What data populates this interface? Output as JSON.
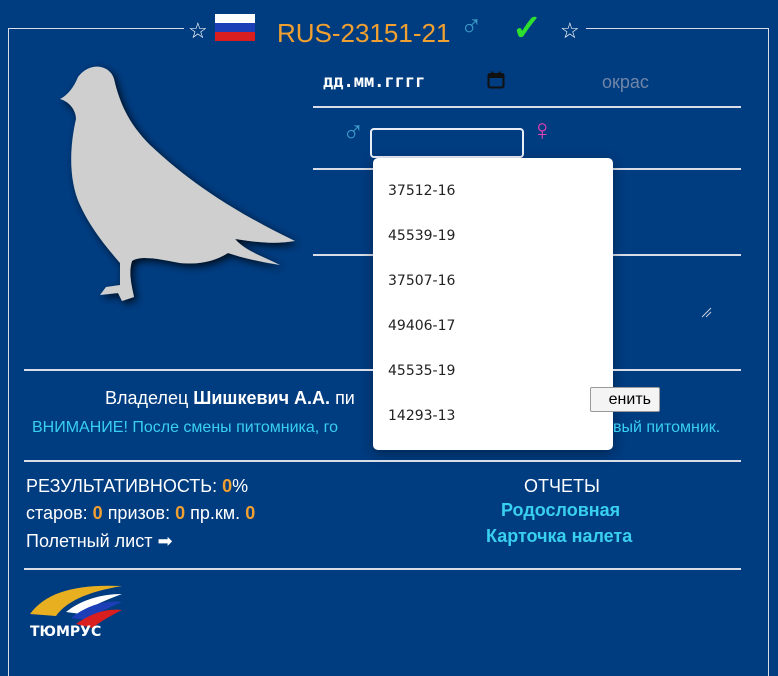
{
  "header": {
    "ring_number": "RUS-23151-21",
    "star_symbol": "☆",
    "male_symbol": "♂",
    "verified_symbol": "✓",
    "flag_colors": [
      "#ffffff",
      "#1c3fb8",
      "#d81e1e"
    ]
  },
  "form": {
    "date_placeholder": "дд.мм.гггг",
    "calendar_icon": "calendar-icon",
    "color_placeholder": "окрас",
    "father_symbol": "♂",
    "mother_symbol": "♀",
    "parent_search_value": ""
  },
  "dropdown": {
    "items": [
      "37512-16",
      "45539-19",
      "37507-16",
      "49406-17",
      "45535-19",
      "14293-13"
    ]
  },
  "owner": {
    "prefix": "Владелец",
    "name": "Шишкевич А.А.",
    "suffix": "пи",
    "change_button": "енить"
  },
  "warning": {
    "left": "ВНИМАНИЕ! После смены питомника, го",
    "right": "вый питомник."
  },
  "stats": {
    "performance_label": "РЕЗУЛЬТАТИВНОСТЬ:",
    "performance_value": "0",
    "percent": "%",
    "starts_label": "старов:",
    "starts_value": "0",
    "prizes_label": "призов:",
    "prizes_value": "0",
    "prkm_label": "пр.км.",
    "prkm_value": "0",
    "flight_sheet": "Полетный лист",
    "flight_arrow": "➡"
  },
  "reports": {
    "title": "ОТЧЕТЫ",
    "pedigree": "Родословная",
    "flight_card": "Карточка налета"
  },
  "logo": {
    "text": "ТЮМРУС"
  },
  "colors": {
    "background": "#003c80",
    "accent": "#f0a030",
    "link": "#39d0f0"
  }
}
